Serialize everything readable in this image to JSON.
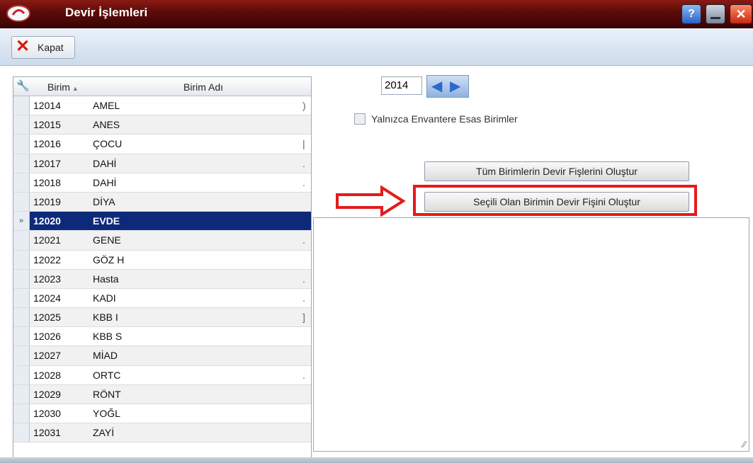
{
  "window": {
    "title": "Devir İşlemleri"
  },
  "toolbar": {
    "close_label": "Kapat"
  },
  "grid": {
    "columns": [
      "Birim",
      "Birim Adı"
    ],
    "rows": [
      {
        "code": "12014",
        "name": "AMEL",
        "mark": ")"
      },
      {
        "code": "12015",
        "name": "ANES",
        "mark": ""
      },
      {
        "code": "12016",
        "name": "ÇOCU",
        "mark": "|"
      },
      {
        "code": "12017",
        "name": "DAHİ",
        "mark": "."
      },
      {
        "code": "12018",
        "name": "DAHİ",
        "mark": "."
      },
      {
        "code": "12019",
        "name": "DİYA",
        "mark": ""
      },
      {
        "code": "12020",
        "name": "EVDE",
        "mark": ""
      },
      {
        "code": "12021",
        "name": "GENE",
        "mark": "."
      },
      {
        "code": "12022",
        "name": "GÖZ H",
        "mark": ""
      },
      {
        "code": "12023",
        "name": "Hasta",
        "mark": "."
      },
      {
        "code": "12024",
        "name": "KADI",
        "mark": "."
      },
      {
        "code": "12025",
        "name": "KBB I",
        "mark": "]"
      },
      {
        "code": "12026",
        "name": "KBB S",
        "mark": ""
      },
      {
        "code": "12027",
        "name": "MİAD",
        "mark": ""
      },
      {
        "code": "12028",
        "name": "ORTC",
        "mark": "."
      },
      {
        "code": "12029",
        "name": "RÖNT",
        "mark": ""
      },
      {
        "code": "12030",
        "name": "YOĞL",
        "mark": ""
      },
      {
        "code": "12031",
        "name": "ZAYİ",
        "mark": ""
      }
    ],
    "selected_row_code": "12020",
    "row_indicator": "»"
  },
  "year": {
    "value": "2014"
  },
  "options": {
    "inventory_only_label": "Yalnızca Envantere Esas Birimler",
    "checked": false
  },
  "actions": {
    "all_units_label": "Tüm Birimlerin Devir Fişlerini Oluştur",
    "selected_unit_label": "Seçili Olan Birimin Devir Fişini Oluştur"
  },
  "colors": {
    "titlebar": "#5c0b08",
    "selected_row": "#0d2a7a",
    "highlight": "#e31b1b"
  },
  "icons": [
    "app-logo-icon",
    "help-icon",
    "minimize-icon",
    "close-window-icon",
    "close-x-icon",
    "wrench-icon",
    "sort-asc-icon",
    "arrow-left-icon",
    "arrow-right-icon",
    "row-indicator-icon",
    "resize-grip-icon"
  ]
}
